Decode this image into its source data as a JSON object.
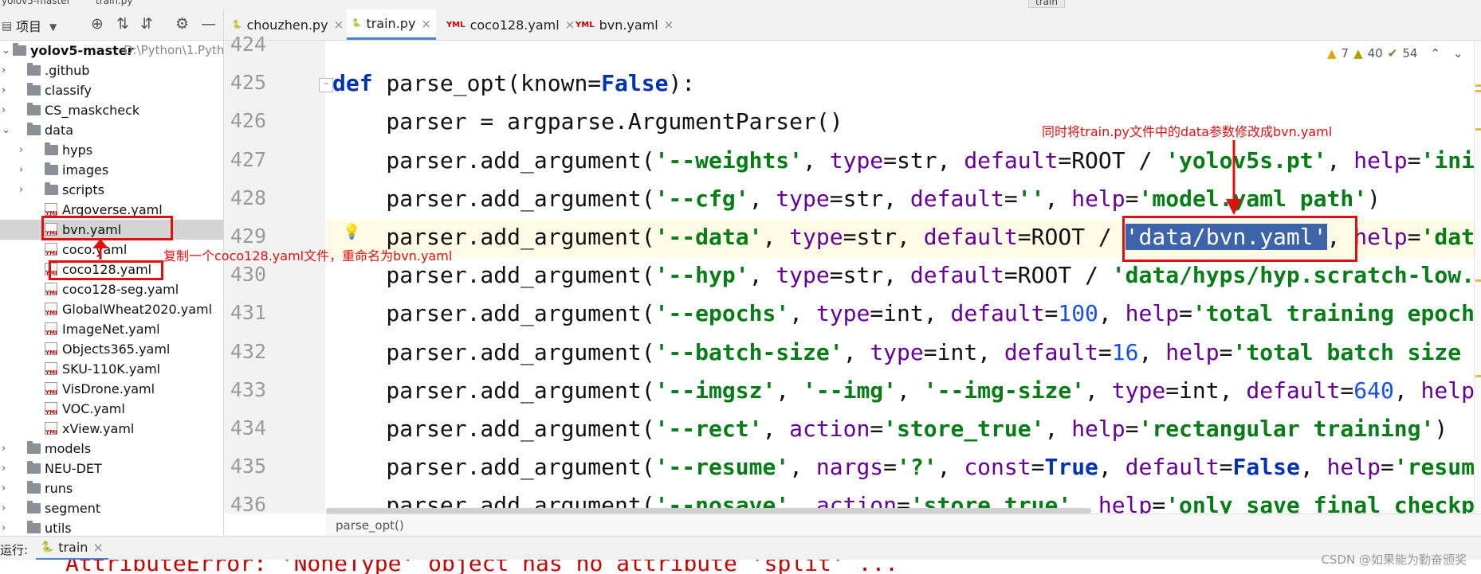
{
  "window": {
    "title_partial": "yolov5-master",
    "file_partial": "train.py",
    "run_config": "train"
  },
  "project_toolbar": {
    "label": "项目"
  },
  "tabs": [
    {
      "label": "chouzhen.py",
      "type": "py",
      "active": false
    },
    {
      "label": "train.py",
      "type": "py",
      "active": true
    },
    {
      "label": "coco128.yaml",
      "type": "yml",
      "active": false
    },
    {
      "label": "bvn.yaml",
      "type": "yml",
      "active": false
    }
  ],
  "tree": {
    "root": {
      "name": "yolov5-master",
      "path": "D:\\Python\\1.Pyth"
    },
    "items": [
      {
        "name": ".github",
        "kind": "folder",
        "depth": 1
      },
      {
        "name": "classify",
        "kind": "folder",
        "depth": 1
      },
      {
        "name": "CS_maskcheck",
        "kind": "folder",
        "depth": 1
      },
      {
        "name": "data",
        "kind": "folder",
        "depth": 1,
        "open": true
      },
      {
        "name": "hyps",
        "kind": "folder",
        "depth": 2
      },
      {
        "name": "images",
        "kind": "folder",
        "depth": 2
      },
      {
        "name": "scripts",
        "kind": "folder",
        "depth": 2
      },
      {
        "name": "Argoverse.yaml",
        "kind": "yml",
        "depth": 2
      },
      {
        "name": "bvn.yaml",
        "kind": "yml",
        "depth": 2,
        "selected": true
      },
      {
        "name": "coco.yaml",
        "kind": "yml",
        "depth": 2
      },
      {
        "name": "coco128.yaml",
        "kind": "yml",
        "depth": 2
      },
      {
        "name": "coco128-seg.yaml",
        "kind": "yml",
        "depth": 2
      },
      {
        "name": "GlobalWheat2020.yaml",
        "kind": "yml",
        "depth": 2
      },
      {
        "name": "ImageNet.yaml",
        "kind": "yml",
        "depth": 2
      },
      {
        "name": "Objects365.yaml",
        "kind": "yml",
        "depth": 2
      },
      {
        "name": "SKU-110K.yaml",
        "kind": "yml",
        "depth": 2
      },
      {
        "name": "VisDrone.yaml",
        "kind": "yml",
        "depth": 2
      },
      {
        "name": "VOC.yaml",
        "kind": "yml",
        "depth": 2
      },
      {
        "name": "xView.yaml",
        "kind": "yml",
        "depth": 2
      },
      {
        "name": "models",
        "kind": "folder",
        "depth": 1
      },
      {
        "name": "NEU-DET",
        "kind": "folder",
        "depth": 1
      },
      {
        "name": "runs",
        "kind": "folder",
        "depth": 1
      },
      {
        "name": "segment",
        "kind": "folder",
        "depth": 1
      },
      {
        "name": "utils",
        "kind": "folder",
        "depth": 1
      }
    ]
  },
  "inspections": {
    "warnings": "7",
    "weak_warnings": "40",
    "ok": "54"
  },
  "code": {
    "line_numbers": [
      "424",
      "425",
      "426",
      "427",
      "428",
      "429",
      "430",
      "431",
      "432",
      "433",
      "434",
      "435",
      "436"
    ],
    "lines": [
      [],
      [
        [
          "kw",
          "def "
        ],
        [
          "fn",
          "parse_opt(known="
        ],
        [
          "kw",
          "False"
        ],
        [
          "fn",
          "):"
        ]
      ],
      [
        [
          "fn",
          "    parser = argparse.ArgumentParser()"
        ]
      ],
      [
        [
          "fn",
          "    parser.add_argument("
        ],
        [
          "str",
          "'--weights'"
        ],
        [
          "fn",
          ", "
        ],
        [
          "kwarg",
          "type"
        ],
        [
          "fn",
          "=str, "
        ],
        [
          "kwarg",
          "default"
        ],
        [
          "fn",
          "=ROOT / "
        ],
        [
          "str",
          "'yolov5s.pt'"
        ],
        [
          "fn",
          ", "
        ],
        [
          "kwarg",
          "help"
        ],
        [
          "fn",
          "="
        ],
        [
          "str",
          "'ini"
        ]
      ],
      [
        [
          "fn",
          "    parser.add_argument("
        ],
        [
          "str",
          "'--cfg'"
        ],
        [
          "fn",
          ", "
        ],
        [
          "kwarg",
          "type"
        ],
        [
          "fn",
          "=str, "
        ],
        [
          "kwarg",
          "default"
        ],
        [
          "fn",
          "="
        ],
        [
          "str",
          "''"
        ],
        [
          "fn",
          ", "
        ],
        [
          "kwarg",
          "help"
        ],
        [
          "fn",
          "="
        ],
        [
          "str",
          "'model.yaml path'"
        ],
        [
          "fn",
          ")"
        ]
      ],
      [
        [
          "fn",
          "    parser.add_argument("
        ],
        [
          "str",
          "'--data'"
        ],
        [
          "fn",
          ", "
        ],
        [
          "kwarg",
          "type"
        ],
        [
          "fn",
          "=str, "
        ],
        [
          "kwarg",
          "default"
        ],
        [
          "fn",
          "=ROOT / "
        ],
        [
          "sel",
          "'data/bvn.yaml'"
        ],
        [
          "fn",
          ", "
        ],
        [
          "kwarg",
          "help"
        ],
        [
          "fn",
          "="
        ],
        [
          "str",
          "'dat"
        ]
      ],
      [
        [
          "fn",
          "    parser.add_argument("
        ],
        [
          "str",
          "'--hyp'"
        ],
        [
          "fn",
          ", "
        ],
        [
          "kwarg",
          "type"
        ],
        [
          "fn",
          "=str, "
        ],
        [
          "kwarg",
          "default"
        ],
        [
          "fn",
          "=ROOT / "
        ],
        [
          "str",
          "'data/hyps/hyp.scratch-low."
        ]
      ],
      [
        [
          "fn",
          "    parser.add_argument("
        ],
        [
          "str",
          "'--epochs'"
        ],
        [
          "fn",
          ", "
        ],
        [
          "kwarg",
          "type"
        ],
        [
          "fn",
          "=int, "
        ],
        [
          "kwarg",
          "default"
        ],
        [
          "fn",
          "="
        ],
        [
          "num",
          "100"
        ],
        [
          "fn",
          ", "
        ],
        [
          "kwarg",
          "help"
        ],
        [
          "fn",
          "="
        ],
        [
          "str",
          "'total training epoch"
        ]
      ],
      [
        [
          "fn",
          "    parser.add_argument("
        ],
        [
          "str",
          "'--batch-size'"
        ],
        [
          "fn",
          ", "
        ],
        [
          "kwarg",
          "type"
        ],
        [
          "fn",
          "=int, "
        ],
        [
          "kwarg",
          "default"
        ],
        [
          "fn",
          "="
        ],
        [
          "num",
          "16"
        ],
        [
          "fn",
          ", "
        ],
        [
          "kwarg",
          "help"
        ],
        [
          "fn",
          "="
        ],
        [
          "str",
          "'total batch size"
        ]
      ],
      [
        [
          "fn",
          "    parser.add_argument("
        ],
        [
          "str",
          "'--imgsz'"
        ],
        [
          "fn",
          ", "
        ],
        [
          "str",
          "'--img'"
        ],
        [
          "fn",
          ", "
        ],
        [
          "str",
          "'--img-size'"
        ],
        [
          "fn",
          ", "
        ],
        [
          "kwarg",
          "type"
        ],
        [
          "fn",
          "=int, "
        ],
        [
          "kwarg",
          "default"
        ],
        [
          "fn",
          "="
        ],
        [
          "num",
          "640"
        ],
        [
          "fn",
          ", "
        ],
        [
          "kwarg",
          "help"
        ]
      ],
      [
        [
          "fn",
          "    parser.add_argument("
        ],
        [
          "str",
          "'--rect'"
        ],
        [
          "fn",
          ", "
        ],
        [
          "kwarg",
          "action"
        ],
        [
          "fn",
          "="
        ],
        [
          "str",
          "'store_true'"
        ],
        [
          "fn",
          ", "
        ],
        [
          "kwarg",
          "help"
        ],
        [
          "fn",
          "="
        ],
        [
          "str",
          "'rectangular training'"
        ],
        [
          "fn",
          ")"
        ]
      ],
      [
        [
          "fn",
          "    parser.add_argument("
        ],
        [
          "str",
          "'--resume'"
        ],
        [
          "fn",
          ", "
        ],
        [
          "kwarg",
          "nargs"
        ],
        [
          "fn",
          "="
        ],
        [
          "str",
          "'?'"
        ],
        [
          "fn",
          ", "
        ],
        [
          "kwarg",
          "const"
        ],
        [
          "fn",
          "="
        ],
        [
          "kw",
          "True"
        ],
        [
          "fn",
          ", "
        ],
        [
          "kwarg",
          "default"
        ],
        [
          "fn",
          "="
        ],
        [
          "kw",
          "False"
        ],
        [
          "fn",
          ", "
        ],
        [
          "kwarg",
          "help"
        ],
        [
          "fn",
          "="
        ],
        [
          "str",
          "'resum"
        ]
      ],
      [
        [
          "fn",
          "    parser.add_argument("
        ],
        [
          "str",
          "'--nosave'"
        ],
        [
          "fn",
          ", "
        ],
        [
          "kwarg",
          "action"
        ],
        [
          "fn",
          "="
        ],
        [
          "str",
          "'store_true'"
        ],
        [
          "fn",
          ", "
        ],
        [
          "kwarg",
          "help"
        ],
        [
          "fn",
          "="
        ],
        [
          "str",
          "'only save final checkp"
        ]
      ]
    ]
  },
  "breadcrumb": "parse_opt()",
  "run_panel": {
    "label": "运行:",
    "tab": "train",
    "output_partial": "AttributeError: 'NoneType' object has no attribute 'split' ..."
  },
  "annotations": {
    "top_note": "同时将train.py文件中的data参数修改成bvn.yaml",
    "tree_note": "复制一个coco128.yaml文件，重命名为bvn.yaml"
  },
  "watermark": "CSDN @如果能为勤奋颁奖",
  "colors": {
    "accent": "#4a83d1",
    "annotation_red": "#e01010",
    "keyword": "#0033b3",
    "string": "#067d17",
    "kwarg": "#660099",
    "number": "#1750eb",
    "selection": "#3d64a8"
  }
}
